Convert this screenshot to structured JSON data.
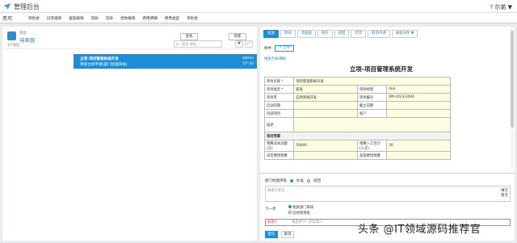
{
  "app": {
    "title": "管理后台",
    "user": "? 尔弟 ▼"
  },
  "menu": {
    "section": "费用",
    "items": [
      "审批屋",
      "日常报销",
      "差旅报销",
      "借款",
      "还款",
      "借款报销",
      "费用明细",
      "费用类型",
      "审批屋"
    ]
  },
  "list": {
    "subtitle": "审批",
    "title": "待审核",
    "count": "1个项目",
    "query_label": "查找",
    "new_label": "新建",
    "search_placeholder": "搜索 审批...",
    "item": {
      "title": "立项-项目管理系统开发",
      "desc": "项目立项申请(部门经理审核)",
      "author": "admin",
      "date": "07-20"
    }
  },
  "detail": {
    "toolbar": [
      "发放",
      "审阅",
      "流程图",
      "保存",
      "退回",
      "打印",
      "取消申请",
      "关联文件 ▼"
    ],
    "attach_label": "附件",
    "upload_label": "上传",
    "template_link": "相关合同/模板",
    "form_title": "立项-项目管理系统开发",
    "rows": [
      [
        "项目名称 *",
        "项目管理系统开发",
        "",
        ""
      ],
      [
        "项目类型 *",
        "研发",
        "项目经理",
        "duk"
      ],
      [
        "项目库",
        "应用系统开发",
        "项目编号",
        "XM-2023-0004"
      ],
      [
        "启动日期",
        "",
        "截止日期",
        ""
      ],
      [
        "内部项目",
        "",
        "客户",
        ""
      ],
      [
        "描述",
        "",
        "",
        ""
      ],
      [
        "项目预算",
        "",
        "",
        ""
      ],
      [
        "预算成本总额(元)",
        "50000",
        "预算人工合计(人天)",
        "30"
      ],
      [
        "日常费用预算",
        "",
        "差旅费用预算",
        ""
      ]
    ]
  },
  "approval": {
    "label": "部门经理审批",
    "opt1": "标准",
    "opt2": "驳回",
    "comment_placeholder": "请填写意见...",
    "quick": [
      "填写",
      "意见"
    ],
    "next_label": "下一步",
    "next_steps": [
      "相关部门审核",
      "总经理审批"
    ],
    "handler_label": "处理人",
    "handler_placeholder": "请选择下一步处理人",
    "submit": "提交",
    "cancel": "取消"
  },
  "watermark": "头条 @IT领域源码推荐官",
  "colors": {
    "accent": "#1f8dd6",
    "field": "#fdfde4"
  }
}
